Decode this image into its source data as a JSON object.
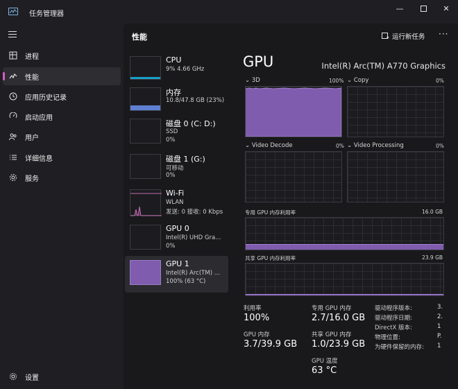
{
  "app": {
    "title": "任务管理器"
  },
  "sidebar": {
    "items": [
      {
        "label": "进程",
        "icon": "processes-icon"
      },
      {
        "label": "性能",
        "icon": "performance-icon"
      },
      {
        "label": "应用历史记录",
        "icon": "app-history-icon"
      },
      {
        "label": "启动应用",
        "icon": "startup-icon"
      },
      {
        "label": "用户",
        "icon": "users-icon"
      },
      {
        "label": "详细信息",
        "icon": "details-icon"
      },
      {
        "label": "服务",
        "icon": "services-icon"
      }
    ],
    "settings": "设置",
    "active_index": 1
  },
  "header": {
    "title": "性能",
    "run_task": "运行新任务",
    "more": "···"
  },
  "devices": [
    {
      "name": "CPU",
      "sub1": "9% 4.66 GHz",
      "sub2": "",
      "sub3": "",
      "usage": 9
    },
    {
      "name": "内存",
      "sub1": "10.8/47.8 GB (23%)",
      "sub2": "",
      "sub3": "",
      "usage": 23
    },
    {
      "name": "磁盘 0 (C: D:)",
      "sub1": "SSD",
      "sub2": "0%",
      "sub3": "",
      "usage": 0
    },
    {
      "name": "磁盘 1 (G:)",
      "sub1": "可移动",
      "sub2": "0%",
      "sub3": "",
      "usage": 0
    },
    {
      "name": "Wi-Fi",
      "sub1": "WLAN",
      "sub2": "发送: 0 接收: 0 Kbps",
      "sub3": "",
      "usage": 0
    },
    {
      "name": "GPU 0",
      "sub1": "Intel(R) UHD Gra...",
      "sub2": "0%",
      "sub3": "",
      "usage": 0
    },
    {
      "name": "GPU 1",
      "sub1": "Intel(R) Arc(TM) ...",
      "sub2": "100% (63 °C)",
      "sub3": "",
      "usage": 100
    }
  ],
  "detail": {
    "title": "GPU",
    "model": "Intel(R) Arc(TM) A770 Graphics",
    "engines": [
      {
        "label": "3D",
        "pct": "100%",
        "usage": 0.95
      },
      {
        "label": "Copy",
        "pct": "0%",
        "usage": 0
      },
      {
        "label": "Video Decode",
        "pct": "0%",
        "usage": 0
      },
      {
        "label": "Video Processing",
        "pct": "0%",
        "usage": 0
      }
    ],
    "dedicated": {
      "label": "专用 GPU 内存利用率",
      "max": "16.0 GB",
      "usage": 0.17
    },
    "shared": {
      "label": "共享 GPU 内存利用率",
      "max": "23.9 GB",
      "usage": 0.04
    },
    "stats": {
      "util_label": "利用率",
      "util_value": "100%",
      "gpu_mem_label": "GPU 内存",
      "gpu_mem_value": "3.7/39.9 GB",
      "ded_label": "专用 GPU 内存",
      "ded_value": "2.7/16.0 GB",
      "shared_label": "共享 GPU 内存",
      "shared_value": "1.0/23.9 GB",
      "temp_label": "GPU 温度",
      "temp_value": "63 °C"
    },
    "info": [
      {
        "label": "驱动程序版本:",
        "value": "3."
      },
      {
        "label": "驱动程序日期:",
        "value": "2."
      },
      {
        "label": "DirectX 版本:",
        "value": "1"
      },
      {
        "label": "物理位置:",
        "value": "P."
      },
      {
        "label": "为硬件保留的内存:",
        "value": "1"
      }
    ]
  },
  "colors": {
    "accent": "#d65cc6",
    "gpu": "#7f5cad",
    "cpu": "#19a0c8",
    "memory": "#5f7fd3",
    "wifi": "#c36bb3"
  }
}
